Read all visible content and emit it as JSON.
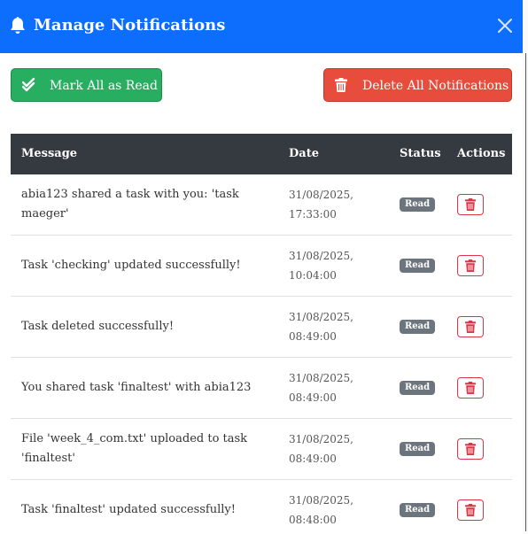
{
  "modal": {
    "title": "Manage Notifications",
    "icons": {
      "title": "bell-icon",
      "close": "close-icon",
      "mark": "double-check-icon",
      "delete_all": "trash-icon",
      "row_delete": "trash-icon"
    }
  },
  "toolbar": {
    "mark_all_label": "Mark All as Read",
    "delete_all_label": "Delete All Notifications"
  },
  "table": {
    "headers": {
      "message": "Message",
      "date": "Date",
      "status": "Status",
      "actions": "Actions"
    },
    "rows": [
      {
        "message": "abia123 shared a task with you: 'task maeger'",
        "date": "31/08/2025, 17:33:00",
        "status": "Read"
      },
      {
        "message": "Task 'checking' updated successfully!",
        "date": "31/08/2025, 10:04:00",
        "status": "Read"
      },
      {
        "message": "Task deleted successfully!",
        "date": "31/08/2025, 08:49:00",
        "status": "Read"
      },
      {
        "message": "You shared task 'finaltest' with abia123",
        "date": "31/08/2025, 08:49:00",
        "status": "Read"
      },
      {
        "message": "File 'week_4_com.txt' uploaded to task 'finaltest'",
        "date": "31/08/2025, 08:49:00",
        "status": "Read"
      },
      {
        "message": "Task 'finaltest' updated successfully!",
        "date": "31/08/2025, 08:48:00",
        "status": "Read"
      }
    ]
  },
  "colors": {
    "header": "#0d6efd",
    "mark_button": "#27ae60",
    "delete_button": "#e74c3c",
    "table_header": "#343a40",
    "badge": "#6c757d",
    "row_delete": "#dc3545"
  }
}
